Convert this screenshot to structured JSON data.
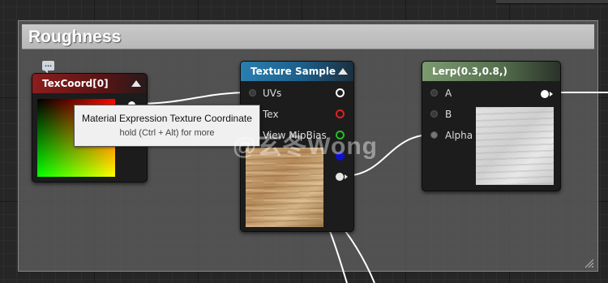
{
  "comment": {
    "title": "Roughness",
    "bubble_glyph": "..."
  },
  "nodes": {
    "texcoord": {
      "title": "TexCoord[0]",
      "header_color": "#8a1e1e"
    },
    "texture_sample": {
      "title": "Texture Sample",
      "header_color": "#1d5e8a",
      "pins": {
        "uvs": "UVs",
        "tex": "Tex",
        "view_mip_bias": "View MipBias"
      }
    },
    "lerp": {
      "title": "Lerp(0.3,0.8,)",
      "header_color": "#5c7a55",
      "pins": {
        "a": "A",
        "b": "B",
        "alpha": "Alpha"
      }
    }
  },
  "tooltip": {
    "title": "Material Expression Texture Coordinate",
    "hint": "hold (Ctrl + Alt) for more"
  },
  "watermark": "@玄冬Wong",
  "icons": {
    "collapse": "triangle-up-icon",
    "comment": "comment-bubble-icon",
    "resize": "resize-grip-icon"
  }
}
